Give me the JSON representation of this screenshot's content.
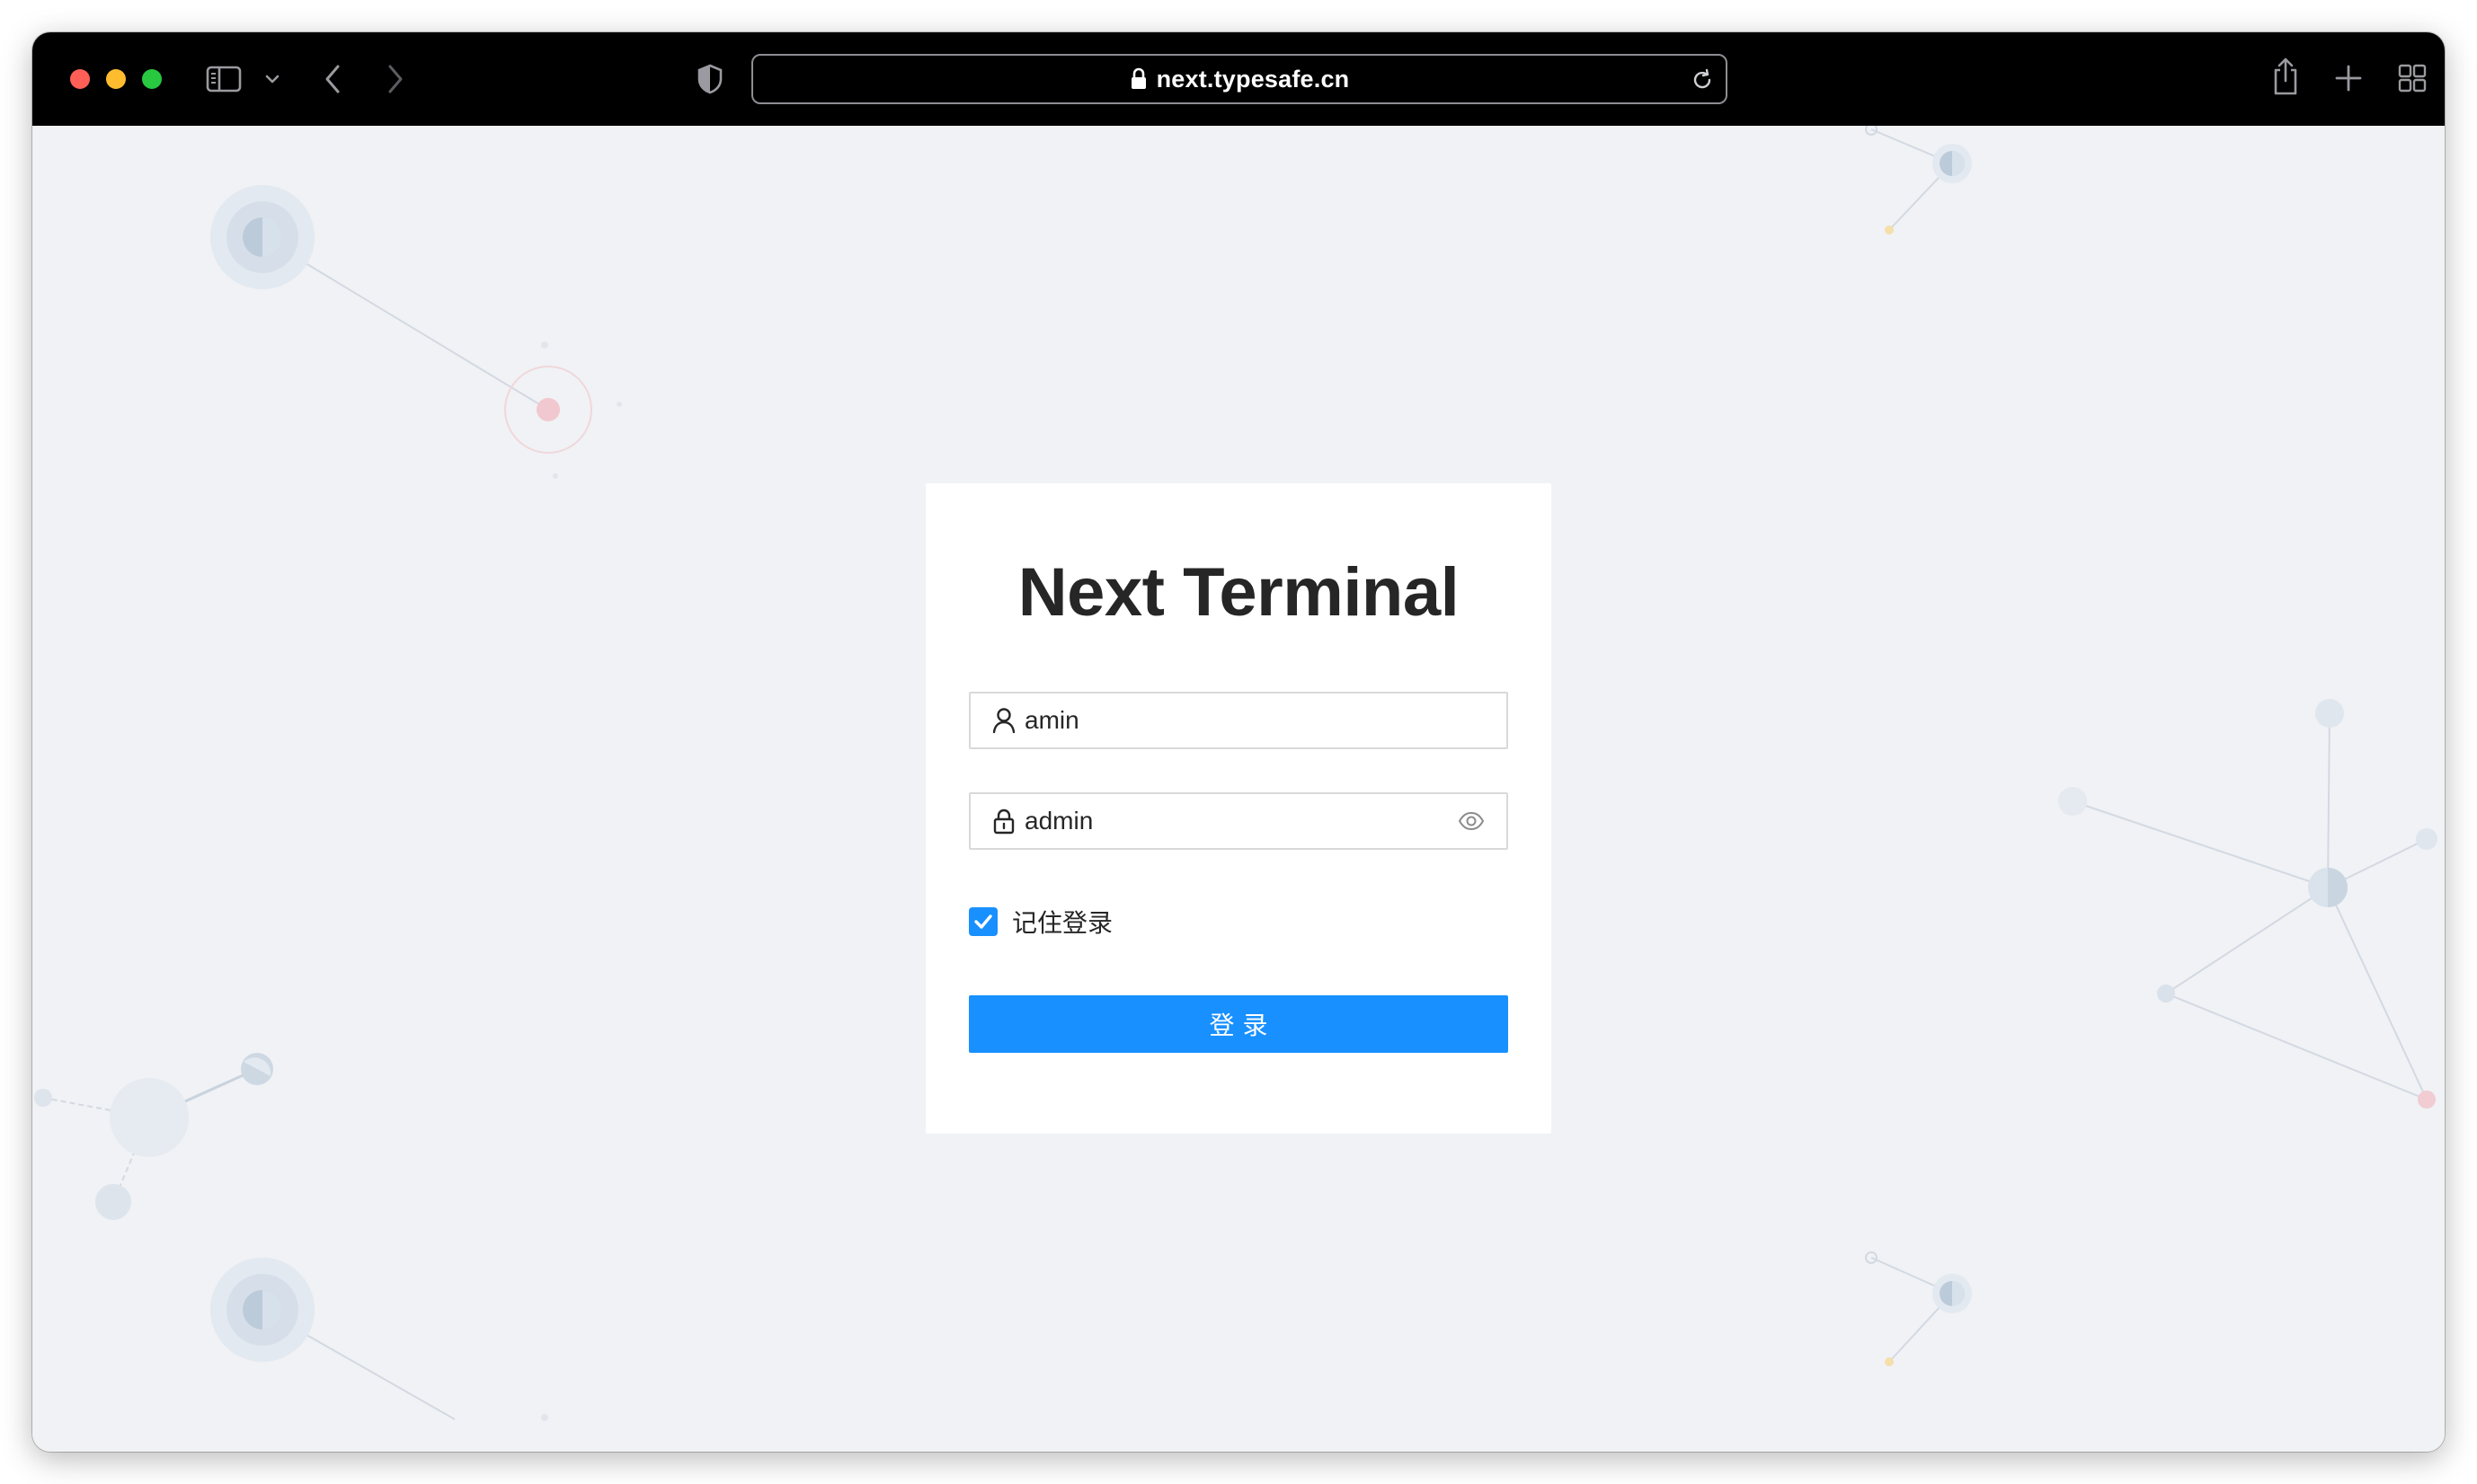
{
  "browser": {
    "url": "next.typesafe.cn",
    "colors": {
      "close": "#ff5f57",
      "minimize": "#febc2e",
      "zoom": "#28c840"
    },
    "icons": [
      "sidebar-icon",
      "chevron-down-icon",
      "back-icon",
      "forward-icon",
      "shield-icon",
      "lock-icon",
      "reload-icon",
      "share-icon",
      "new-tab-icon",
      "tab-overview-icon"
    ]
  },
  "login": {
    "title": "Next Terminal",
    "username_value": "amin",
    "password_value": "admin",
    "remember_label": "记住登录",
    "remember_checked": true,
    "submit_label": "登 录",
    "accent_color": "#1890ff"
  }
}
